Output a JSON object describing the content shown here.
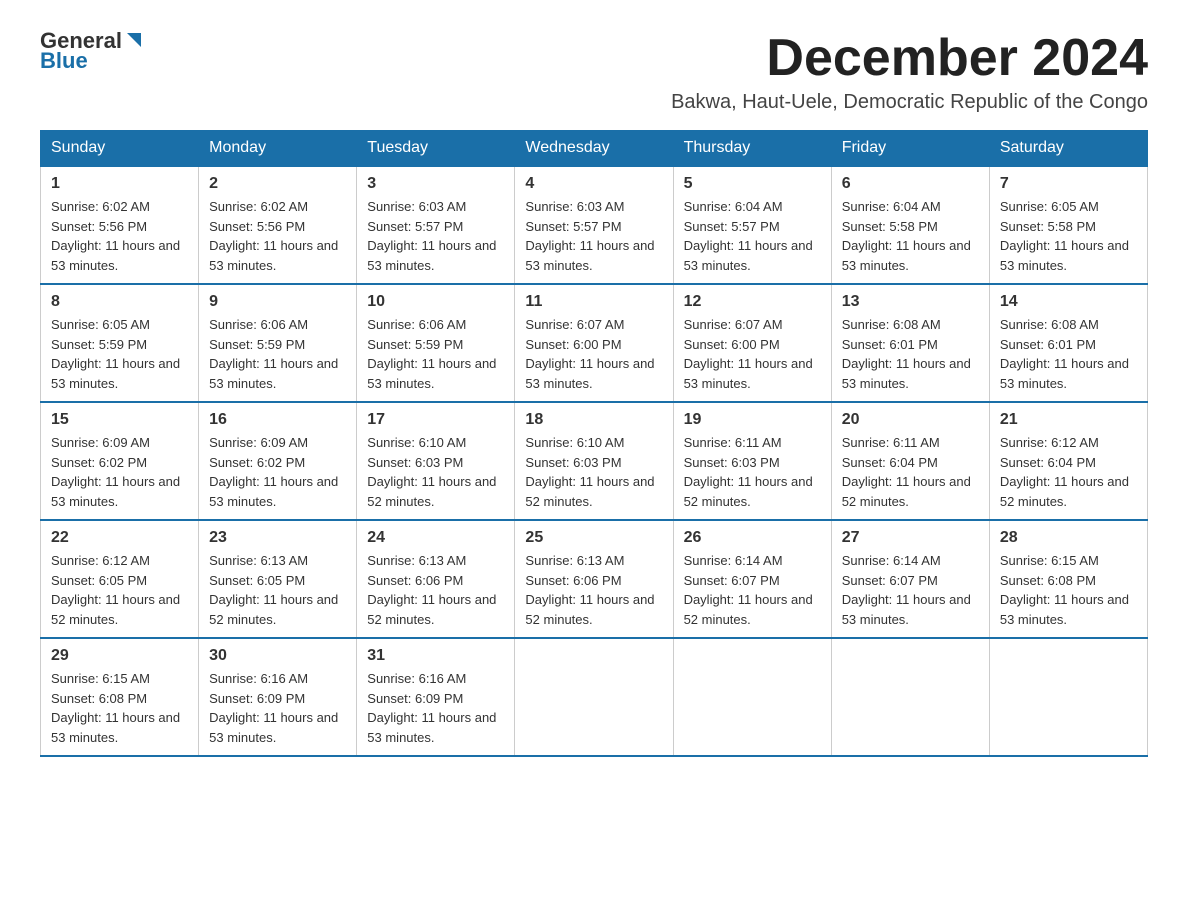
{
  "logo": {
    "general": "General",
    "blue": "Blue"
  },
  "header": {
    "month_year": "December 2024",
    "location": "Bakwa, Haut-Uele, Democratic Republic of the Congo"
  },
  "weekdays": [
    "Sunday",
    "Monday",
    "Tuesday",
    "Wednesday",
    "Thursday",
    "Friday",
    "Saturday"
  ],
  "weeks": [
    [
      {
        "day": "1",
        "sunrise": "6:02 AM",
        "sunset": "5:56 PM",
        "daylight": "11 hours and 53 minutes."
      },
      {
        "day": "2",
        "sunrise": "6:02 AM",
        "sunset": "5:56 PM",
        "daylight": "11 hours and 53 minutes."
      },
      {
        "day": "3",
        "sunrise": "6:03 AM",
        "sunset": "5:57 PM",
        "daylight": "11 hours and 53 minutes."
      },
      {
        "day": "4",
        "sunrise": "6:03 AM",
        "sunset": "5:57 PM",
        "daylight": "11 hours and 53 minutes."
      },
      {
        "day": "5",
        "sunrise": "6:04 AM",
        "sunset": "5:57 PM",
        "daylight": "11 hours and 53 minutes."
      },
      {
        "day": "6",
        "sunrise": "6:04 AM",
        "sunset": "5:58 PM",
        "daylight": "11 hours and 53 minutes."
      },
      {
        "day": "7",
        "sunrise": "6:05 AM",
        "sunset": "5:58 PM",
        "daylight": "11 hours and 53 minutes."
      }
    ],
    [
      {
        "day": "8",
        "sunrise": "6:05 AM",
        "sunset": "5:59 PM",
        "daylight": "11 hours and 53 minutes."
      },
      {
        "day": "9",
        "sunrise": "6:06 AM",
        "sunset": "5:59 PM",
        "daylight": "11 hours and 53 minutes."
      },
      {
        "day": "10",
        "sunrise": "6:06 AM",
        "sunset": "5:59 PM",
        "daylight": "11 hours and 53 minutes."
      },
      {
        "day": "11",
        "sunrise": "6:07 AM",
        "sunset": "6:00 PM",
        "daylight": "11 hours and 53 minutes."
      },
      {
        "day": "12",
        "sunrise": "6:07 AM",
        "sunset": "6:00 PM",
        "daylight": "11 hours and 53 minutes."
      },
      {
        "day": "13",
        "sunrise": "6:08 AM",
        "sunset": "6:01 PM",
        "daylight": "11 hours and 53 minutes."
      },
      {
        "day": "14",
        "sunrise": "6:08 AM",
        "sunset": "6:01 PM",
        "daylight": "11 hours and 53 minutes."
      }
    ],
    [
      {
        "day": "15",
        "sunrise": "6:09 AM",
        "sunset": "6:02 PM",
        "daylight": "11 hours and 53 minutes."
      },
      {
        "day": "16",
        "sunrise": "6:09 AM",
        "sunset": "6:02 PM",
        "daylight": "11 hours and 53 minutes."
      },
      {
        "day": "17",
        "sunrise": "6:10 AM",
        "sunset": "6:03 PM",
        "daylight": "11 hours and 52 minutes."
      },
      {
        "day": "18",
        "sunrise": "6:10 AM",
        "sunset": "6:03 PM",
        "daylight": "11 hours and 52 minutes."
      },
      {
        "day": "19",
        "sunrise": "6:11 AM",
        "sunset": "6:03 PM",
        "daylight": "11 hours and 52 minutes."
      },
      {
        "day": "20",
        "sunrise": "6:11 AM",
        "sunset": "6:04 PM",
        "daylight": "11 hours and 52 minutes."
      },
      {
        "day": "21",
        "sunrise": "6:12 AM",
        "sunset": "6:04 PM",
        "daylight": "11 hours and 52 minutes."
      }
    ],
    [
      {
        "day": "22",
        "sunrise": "6:12 AM",
        "sunset": "6:05 PM",
        "daylight": "11 hours and 52 minutes."
      },
      {
        "day": "23",
        "sunrise": "6:13 AM",
        "sunset": "6:05 PM",
        "daylight": "11 hours and 52 minutes."
      },
      {
        "day": "24",
        "sunrise": "6:13 AM",
        "sunset": "6:06 PM",
        "daylight": "11 hours and 52 minutes."
      },
      {
        "day": "25",
        "sunrise": "6:13 AM",
        "sunset": "6:06 PM",
        "daylight": "11 hours and 52 minutes."
      },
      {
        "day": "26",
        "sunrise": "6:14 AM",
        "sunset": "6:07 PM",
        "daylight": "11 hours and 52 minutes."
      },
      {
        "day": "27",
        "sunrise": "6:14 AM",
        "sunset": "6:07 PM",
        "daylight": "11 hours and 53 minutes."
      },
      {
        "day": "28",
        "sunrise": "6:15 AM",
        "sunset": "6:08 PM",
        "daylight": "11 hours and 53 minutes."
      }
    ],
    [
      {
        "day": "29",
        "sunrise": "6:15 AM",
        "sunset": "6:08 PM",
        "daylight": "11 hours and 53 minutes."
      },
      {
        "day": "30",
        "sunrise": "6:16 AM",
        "sunset": "6:09 PM",
        "daylight": "11 hours and 53 minutes."
      },
      {
        "day": "31",
        "sunrise": "6:16 AM",
        "sunset": "6:09 PM",
        "daylight": "11 hours and 53 minutes."
      },
      null,
      null,
      null,
      null
    ]
  ],
  "colors": {
    "header_bg": "#1a6fa8",
    "header_text": "#ffffff",
    "border": "#1a6fa8"
  }
}
